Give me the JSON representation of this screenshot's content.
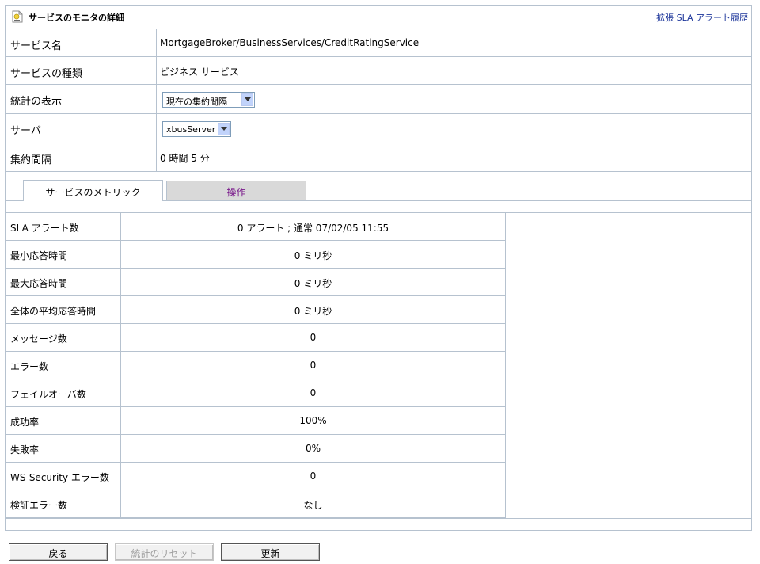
{
  "header": {
    "title": "サービスのモニタの詳細",
    "link": "拡張 SLA アラート履歴"
  },
  "info": [
    {
      "label": "サービス名",
      "value": "MortgageBroker/BusinessServices/CreditRatingService"
    },
    {
      "label": "サービスの種類",
      "value": "ビジネス サービス"
    },
    {
      "label": "統計の表示",
      "select": "現在の集約間隔"
    },
    {
      "label": "サーバ",
      "select": "xbusServer"
    },
    {
      "label": "集約間隔",
      "value": "0 時間 5 分"
    }
  ],
  "tabs": [
    {
      "label": "サービスのメトリック"
    },
    {
      "label": "操作"
    }
  ],
  "metrics": [
    {
      "label": "SLA アラート数",
      "value": "0 アラート ; 通常 07/02/05 11:55"
    },
    {
      "label": "最小応答時間",
      "value": "0 ミリ秒"
    },
    {
      "label": "最大応答時間",
      "value": "0 ミリ秒"
    },
    {
      "label": "全体の平均応答時間",
      "value": "0 ミリ秒"
    },
    {
      "label": "メッセージ数",
      "value": "0"
    },
    {
      "label": "エラー数",
      "value": "0"
    },
    {
      "label": "フェイルオーバ数",
      "value": "0"
    },
    {
      "label": "成功率",
      "value": "100%"
    },
    {
      "label": "失敗率",
      "value": "0%"
    },
    {
      "label": "WS-Security エラー数",
      "value": "0"
    },
    {
      "label": "検証エラー数",
      "value": "なし"
    }
  ],
  "buttons": {
    "back": "戻る",
    "reset": "統計のリセット",
    "refresh": "更新"
  },
  "colors": {
    "border": "#b6c2cf",
    "link": "#1a3399",
    "tab_active_text": "#7a1a8c",
    "tab_inactive_bg": "#d9d9d9"
  }
}
